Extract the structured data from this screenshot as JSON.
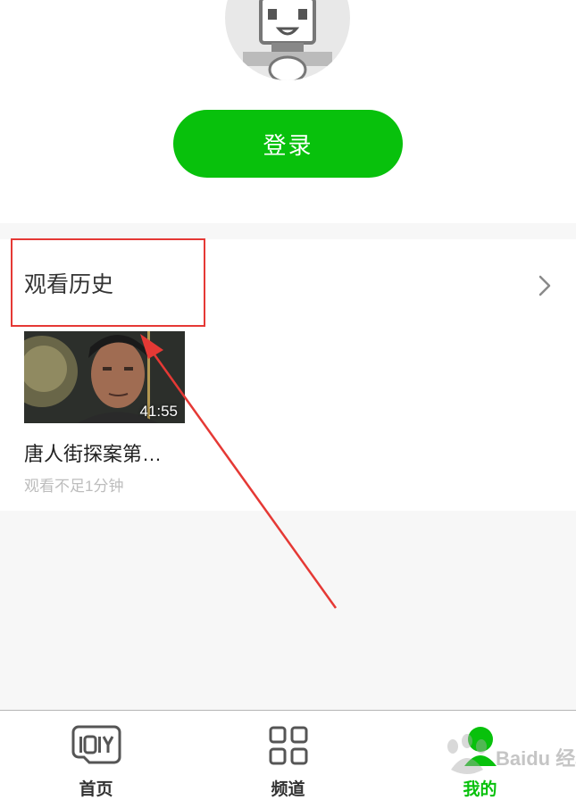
{
  "profile": {
    "avatar_icon": "default-tv-avatar-icon",
    "login_label": "登录"
  },
  "history": {
    "title": "观看历史",
    "chevron_icon": "chevron-right-icon",
    "items": [
      {
        "title": "唐人街探案第…",
        "duration": "41:55",
        "progress": "观看不足1分钟"
      }
    ]
  },
  "tabbar": {
    "tabs": [
      {
        "label": "首页",
        "icon": "iqiyi-logo-icon",
        "active": false
      },
      {
        "label": "频道",
        "icon": "grid-icon",
        "active": false
      },
      {
        "label": "我的",
        "icon": "user-icon",
        "active": true
      }
    ]
  },
  "watermark": {
    "text": "Baidu 经验"
  },
  "colors": {
    "accent": "#08c10c",
    "annotation": "#e53935",
    "background": "#f7f7f7"
  }
}
